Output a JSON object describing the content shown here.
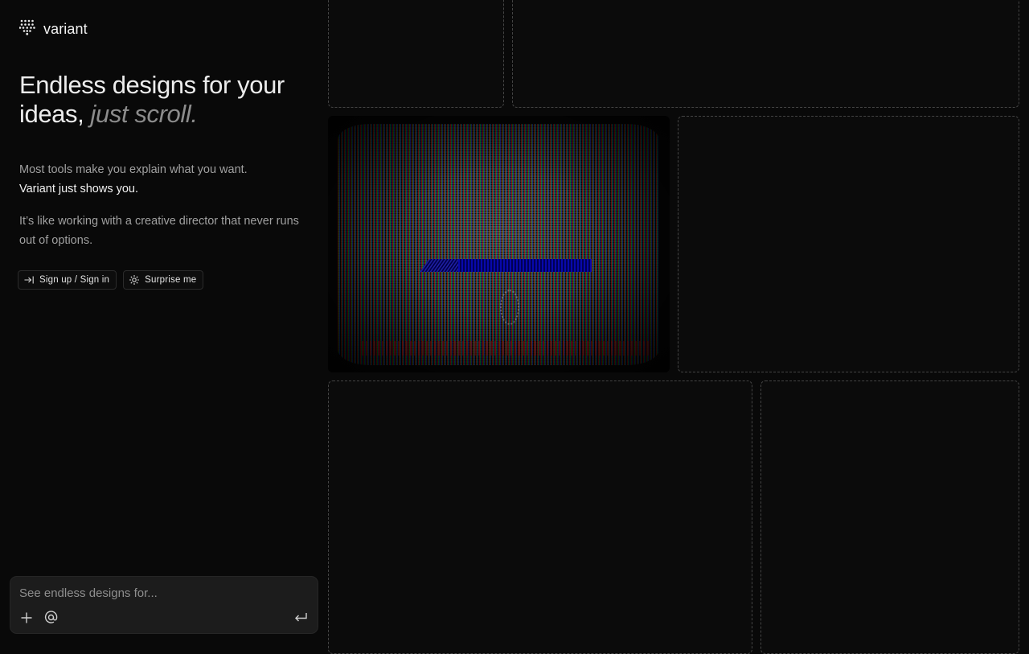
{
  "brand": {
    "name": "variant",
    "logo_icon": "dotted-arrow-logo-icon"
  },
  "hero": {
    "title_main": "Endless designs for your ideas,",
    "title_emphasis": "just scroll."
  },
  "intro": {
    "line1": "Most tools make you explain what you want.",
    "line2": "Variant just shows you.",
    "paragraph2": "It’s like working with a creative director that never runs out of options."
  },
  "actions": {
    "signup_label": "Sign up / Sign in",
    "signup_icon": "arrow-to-bar-icon",
    "surprise_label": "Surprise me",
    "surprise_icon": "sparkle-icon"
  },
  "prompt": {
    "placeholder": "See endless designs for...",
    "add_icon": "plus-icon",
    "mention_icon": "at-icon",
    "submit_icon": "enter-return-icon"
  },
  "colors": {
    "background": "#090909",
    "tile_border": "#444444",
    "prompt_bg": "#1c1c1c",
    "accent_text": "#f2f2f2",
    "muted_text": "#a0a0a0"
  }
}
